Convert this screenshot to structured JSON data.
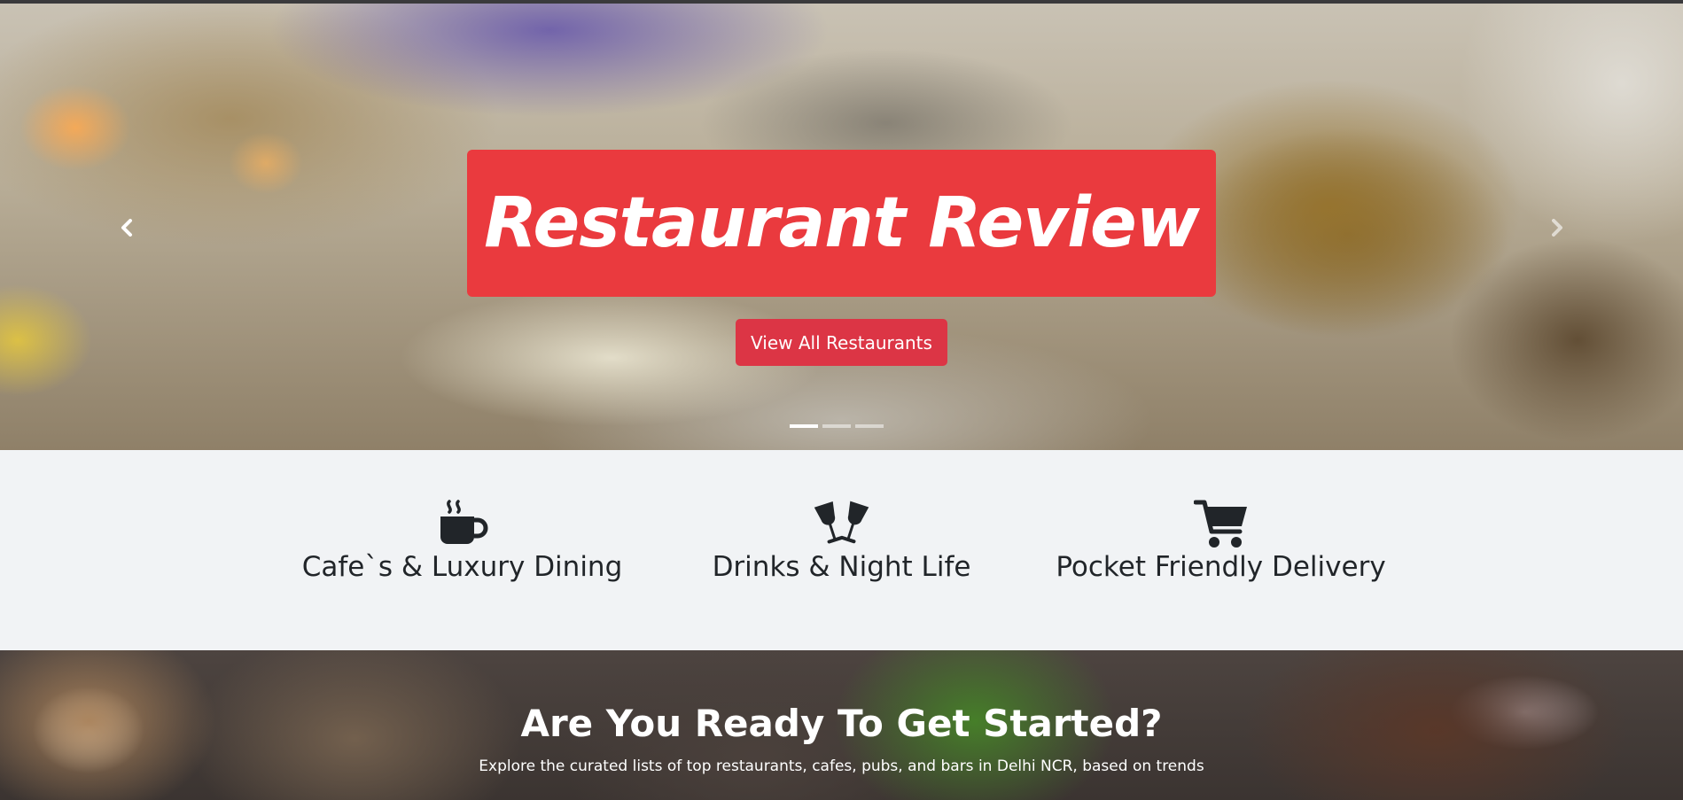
{
  "hero": {
    "title": "Restaurant Review",
    "button_label": "View All Restaurants",
    "prev_icon": "chevron-left-icon",
    "next_icon": "chevron-right-icon",
    "indicators": [
      {
        "label": "slide-1",
        "active": true
      },
      {
        "label": "slide-2",
        "active": false
      },
      {
        "label": "slide-3",
        "active": false
      }
    ],
    "title_background_color": "#ea3a3e",
    "button_color": "#dc3545"
  },
  "features": {
    "items": [
      {
        "icon": "coffee-cup-icon",
        "label": "Cafe`s & Luxury Dining"
      },
      {
        "icon": "wine-glasses-cheers-icon",
        "label": "Drinks & Night Life"
      },
      {
        "icon": "shopping-cart-icon",
        "label": "Pocket Friendly Delivery"
      }
    ],
    "background_color": "#f1f3f5"
  },
  "cta": {
    "title": "Are You Ready To Get Started?",
    "subtitle": "Explore the curated lists of top restaurants, cafes, pubs, and bars in Delhi NCR, based on trends"
  }
}
